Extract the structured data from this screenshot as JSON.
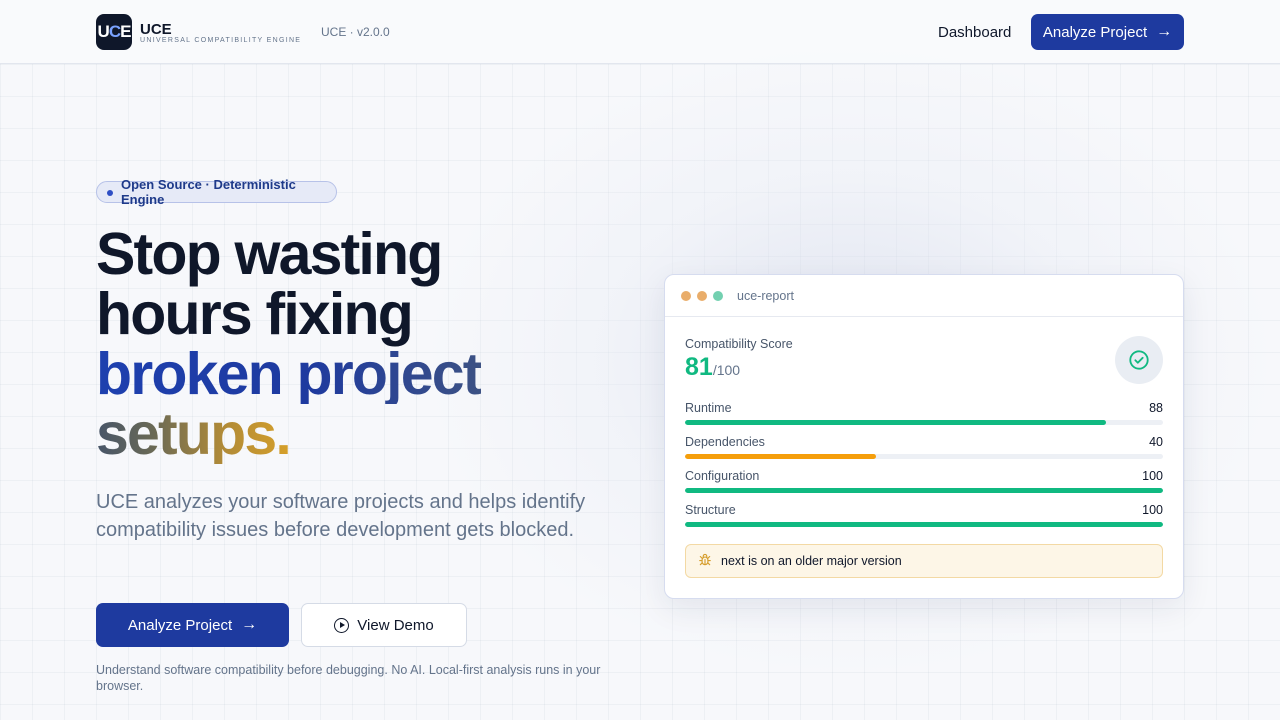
{
  "nav": {
    "logo_mark_u": "U",
    "logo_mark_c": "C",
    "logo_mark_e": "E",
    "brand_name": "UCE",
    "brand_tagline": "UNIVERSAL COMPATIBILITY ENGINE",
    "version": "UCE · v2.0.0",
    "dashboard_link": "Dashboard",
    "cta_label": "Analyze Project",
    "cta_icon": "arrow-right-icon"
  },
  "hero": {
    "badge": "Open Source · Deterministic Engine",
    "headline_line1": "Stop wasting",
    "headline_line2": "hours fixing",
    "headline_line3": "broken project",
    "headline_line4": "setups.",
    "lead": "UCE analyzes your software projects and helps identify compatibility issues before development gets blocked.",
    "primary_button": "Analyze Project",
    "secondary_button": "View Demo",
    "secondary_icon": "play-circle-icon",
    "fineprint": "Understand software compatibility before debugging. No AI. Local-first analysis runs in your browser."
  },
  "report": {
    "window_title": "uce-report",
    "score_label": "Compatibility Score",
    "score_value": "81",
    "score_max": "/100",
    "score_icon": "check-circle-icon",
    "metrics": [
      {
        "name": "Runtime",
        "value": "88",
        "fraction": 0.88,
        "color": "#10b981"
      },
      {
        "name": "Dependencies",
        "value": "40",
        "fraction": 0.4,
        "color": "#f59e0b"
      },
      {
        "name": "Configuration",
        "value": "100",
        "fraction": 1.0,
        "color": "#10b981"
      },
      {
        "name": "Structure",
        "value": "100",
        "fraction": 1.0,
        "color": "#10b981"
      }
    ],
    "warning_icon": "bug-icon",
    "warning": "next is on an older major version"
  },
  "colors": {
    "brand": "#1e3a9f",
    "success": "#10b981",
    "warning": "#f59e0b"
  }
}
